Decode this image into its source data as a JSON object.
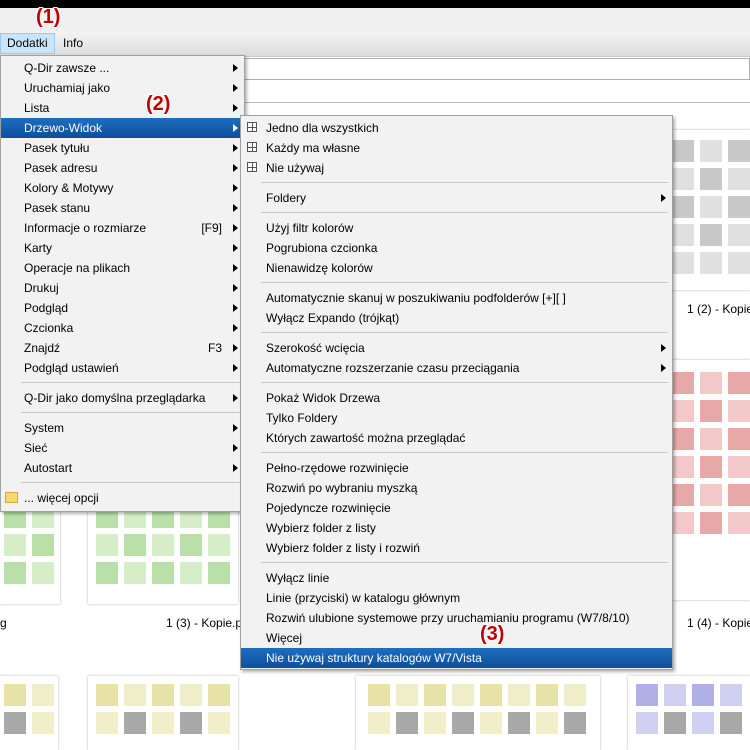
{
  "menubar": {
    "items": [
      "Dodatki",
      "Info"
    ]
  },
  "badges": {
    "b1": "(1)",
    "b2": "(2)",
    "b3": "(3)"
  },
  "main_menu": {
    "items": [
      {
        "label": "Q-Dir zawsze ...",
        "submenu": true
      },
      {
        "label": "Uruchamiaj jako",
        "submenu": true
      },
      {
        "label": "Lista",
        "submenu": true
      },
      {
        "label": "Drzewo-Widok",
        "submenu": true,
        "highlighted": true
      },
      {
        "label": "Pasek tytułu",
        "submenu": true
      },
      {
        "label": "Pasek adresu",
        "submenu": true
      },
      {
        "label": "Kolory & Motywy",
        "submenu": true
      },
      {
        "label": "Pasek stanu",
        "submenu": true
      },
      {
        "label": "Informacje o rozmiarze",
        "shortcut": "[F9]",
        "submenu": true
      },
      {
        "label": "Karty",
        "submenu": true
      },
      {
        "label": "Operacje na plikach",
        "submenu": true
      },
      {
        "label": "Drukuj",
        "submenu": true
      },
      {
        "label": "Podgląd",
        "submenu": true
      },
      {
        "label": "Czcionka",
        "submenu": true
      },
      {
        "label": "Znajdź",
        "shortcut": "F3",
        "submenu": true
      },
      {
        "label": "Podgląd ustawień",
        "submenu": true
      },
      {
        "label": "Q-Dir jako domyślna przeglądarka",
        "submenu": true
      },
      {
        "label": "System",
        "submenu": true
      },
      {
        "label": "Sieć",
        "submenu": true
      },
      {
        "label": "Autostart",
        "submenu": true
      },
      {
        "label": "... więcej opcji"
      }
    ]
  },
  "sub_menu": {
    "items": [
      {
        "label": "Jedno dla wszystkich",
        "icon": "tree-grid-icon"
      },
      {
        "label": "Każdy ma własne",
        "icon": "tree-grid-icon"
      },
      {
        "label": "Nie używaj",
        "icon": "tree-grid-icon"
      },
      {
        "label": "Foldery",
        "submenu": true
      },
      {
        "label": "Użyj filtr kolorów"
      },
      {
        "label": "Pogrubiona czcionka"
      },
      {
        "label": "Nienawidzę kolorów"
      },
      {
        "label": "Automatycznie skanuj w poszukiwaniu podfolderów [+][ ]"
      },
      {
        "label": "Wyłącz Expando (trójkąt)"
      },
      {
        "label": "Szerokość wcięcia",
        "submenu": true
      },
      {
        "label": "Automatyczne rozszerzanie czasu przeciągania",
        "submenu": true
      },
      {
        "label": "Pokaż Widok Drzewa"
      },
      {
        "label": "Tylko Foldery"
      },
      {
        "label": "Których zawartość można przeglądać"
      },
      {
        "label": "Pełno-rzędowe rozwinięcie"
      },
      {
        "label": "Rozwiń po wybraniu myszką"
      },
      {
        "label": "Pojedyncze rozwinięcie"
      },
      {
        "label": "Wybierz folder z listy"
      },
      {
        "label": "Wybierz folder z listy i rozwiń"
      },
      {
        "label": "Wyłącz linie"
      },
      {
        "label": "Linie (przyciski) w katalogu głównym"
      },
      {
        "label": "Rozwiń ulubione systemowe przy uruchamianiu programu (W7/8/10)"
      },
      {
        "label": "Więcej"
      },
      {
        "label": "Nie używaj struktury katalogów W7/Vista",
        "highlighted": true
      }
    ]
  },
  "captions": [
    "1 (2) - Kopie",
    "g",
    "1 (3) - Kopie.p",
    "1 (4) - Kopie"
  ],
  "colors": {
    "highlight": "#1565b8",
    "badge": "#c00000",
    "thumb_gray": "#c8c8c8",
    "thumb_green": "#b8e0a8",
    "thumb_red": "#e8a8a8",
    "thumb_yellow": "#e6e2a8",
    "thumb_blue": "#b0b0e6"
  }
}
